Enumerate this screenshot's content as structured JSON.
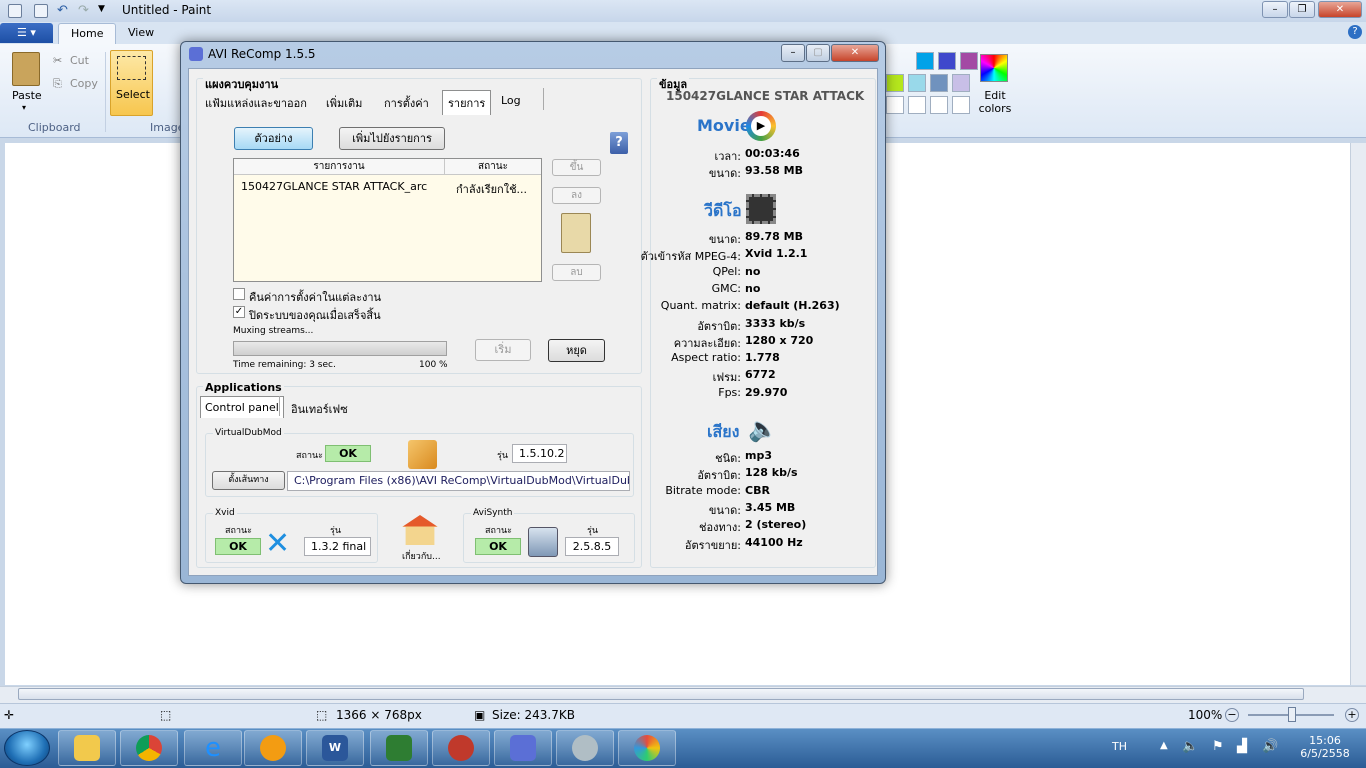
{
  "paint": {
    "title": "Untitled - Paint",
    "tabs": [
      "Home",
      "View"
    ],
    "clipboard": {
      "paste": "Paste",
      "cut": "Cut",
      "copy": "Copy",
      "group": "Clipboard"
    },
    "image": {
      "select": "Select",
      "group": "Image"
    },
    "edit_colors": "Edit colors",
    "status": {
      "dimensions": "1366 × 768px",
      "size": "Size: 243.7KB",
      "zoom": "100%"
    },
    "palette": [
      "#00a2e8",
      "#3f48cc",
      "#a349a4",
      "#b5e61d",
      "#99d9ea",
      "#7092be",
      "#c8bfe7",
      "#ffffff",
      "#ffffff",
      "#ffffff",
      "#ffffff"
    ]
  },
  "dialog": {
    "title": "AVI ReComp  1.5.5",
    "control_header": "แผงควบคุมงาน",
    "tabs": [
      "แฟ้มแหล่งและขาออก",
      "เพิ่มเติม",
      "การตั้งค่า",
      "รายการ",
      "Log"
    ],
    "preview_button": "ตัวอย่าง",
    "add_to_list_button": "เพิ่มไปยังรายการ",
    "queue": {
      "col_job": "รายการงาน",
      "col_status": "สถานะ",
      "rows": [
        {
          "job": "150427GLANCE STAR ATTACK_arc",
          "status": "กำลังเรียกใช้..."
        }
      ]
    },
    "up_button": "ขึ้น",
    "down_button": "ลง",
    "remove_button": "ลบ",
    "restore_settings": "คืนค่าการตั้งค่าในแต่ละงาน",
    "shutdown_when_done": "ปิดระบบของคุณเมื่อเสร็จสิ้น",
    "progress_label": "Muxing streams...",
    "progress": 1.0,
    "time_remaining": "Time remaining: 3 sec.",
    "percent": "100 %",
    "start_button": "เริ่ม",
    "stop_button": "หยุด",
    "applications": {
      "header": "Applications",
      "tabs": [
        "Control panel",
        "อินเทอร์เฟซ"
      ],
      "virtualdubmod": {
        "title": "VirtualDubMod",
        "status_label": "สถานะ",
        "status": "OK",
        "version_label": "รุ่น",
        "version": "1.5.10.2",
        "path_button": "ตั้งเส้นทาง",
        "path": "C:\\Program Files (x86)\\AVI ReComp\\VirtualDubMod\\VirtualDubMod.exe"
      },
      "xvid": {
        "title": "Xvid",
        "status_label": "สถานะ",
        "status": "OK",
        "version_label": "รุ่น",
        "version": "1.3.2 final"
      },
      "about": "เกี่ยวกับ...",
      "avisynth": {
        "title": "AviSynth",
        "status_label": "สถานะ",
        "status": "OK",
        "version_label": "รุ่น",
        "version": "2.5.8.5"
      }
    },
    "info": {
      "header": "ข้อมูล",
      "file_name": "150427GLANCE STAR ATTACK",
      "movie_title": "Movie",
      "movie": [
        [
          "เวลา:",
          "00:03:46"
        ],
        [
          "ขนาด:",
          "93.58 MB"
        ]
      ],
      "video_title": "วีดีโอ",
      "video": [
        [
          "ขนาด:",
          "89.78 MB"
        ],
        [
          "ตัวเข้ารหัส MPEG-4:",
          "Xvid 1.2.1"
        ],
        [
          "QPel:",
          "no"
        ],
        [
          "GMC:",
          "no"
        ],
        [
          "Quant. matrix:",
          "default (H.263)"
        ],
        [
          "อัตราบิต:",
          "3333 kb/s"
        ],
        [
          "ความละเอียด:",
          "1280 x 720"
        ],
        [
          "Aspect ratio:",
          "1.778"
        ],
        [
          "เฟรม:",
          "6772"
        ],
        [
          "Fps:",
          "29.970"
        ]
      ],
      "audio_title": "เสียง",
      "audio": [
        [
          "ชนิด:",
          "mp3"
        ],
        [
          "อัตราบิต:",
          "128 kb/s"
        ],
        [
          "Bitrate mode:",
          "CBR"
        ],
        [
          "ขนาด:",
          "3.45 MB"
        ],
        [
          "ช่องทาง:",
          "2 (stereo)"
        ],
        [
          "อัตราขยาย:",
          "44100 Hz"
        ]
      ]
    }
  },
  "taskbar": {
    "lang": "TH",
    "time": "15:06",
    "date": "6/5/2558"
  }
}
